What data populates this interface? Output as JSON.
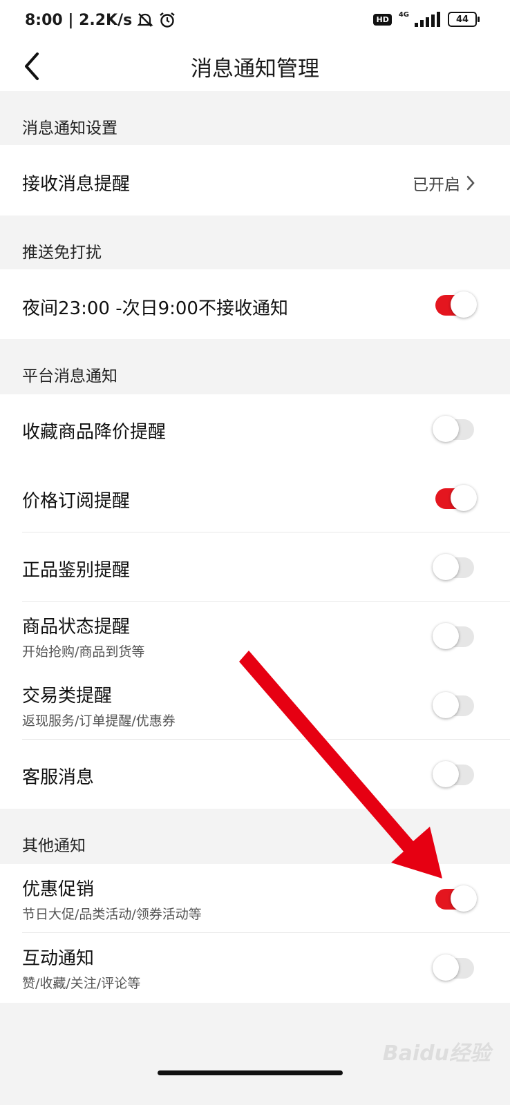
{
  "status_bar": {
    "time_speed": "8:00 | 2.2K/s",
    "hd_label": "HD",
    "network_label": "4G",
    "battery": "44",
    "icons": [
      "bell-off-icon",
      "alarm-icon",
      "signal-icon",
      "battery-icon"
    ]
  },
  "header": {
    "title": "消息通知管理",
    "back_icon": "chevron-left-icon"
  },
  "sections": {
    "message_settings": {
      "title": "消息通知设置",
      "receive": {
        "label": "接收消息提醒",
        "value": "已开启"
      }
    },
    "dnd": {
      "title": "推送免打扰",
      "night": {
        "label": "夜间23:00 -次日9:00不接收通知",
        "on": true
      }
    },
    "platform": {
      "title": "平台消息通知",
      "items": [
        {
          "label": "收藏商品降价提醒",
          "on": false
        },
        {
          "label": "价格订阅提醒",
          "on": true
        },
        {
          "label": "正品鉴别提醒",
          "on": false
        },
        {
          "label": "商品状态提醒",
          "sub": "开始抢购/商品到货等",
          "on": false
        },
        {
          "label": "交易类提醒",
          "sub": "返现服务/订单提醒/优惠券",
          "on": false
        },
        {
          "label": "客服消息",
          "on": false
        }
      ]
    },
    "other": {
      "title": "其他通知",
      "items": [
        {
          "label": "优惠促销",
          "sub": "节日大促/品类活动/领券活动等",
          "on": true
        },
        {
          "label": "互动通知",
          "sub": "赞/收藏/关注/评论等",
          "on": false
        }
      ]
    }
  },
  "watermark": "Baidu经验",
  "colors": {
    "accent": "#e4161f",
    "annotation_arrow": "#e60012"
  }
}
